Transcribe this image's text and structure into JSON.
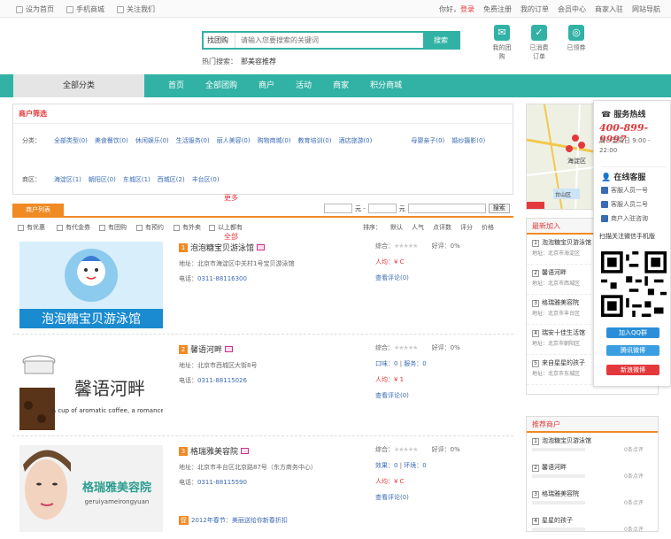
{
  "topbar": {
    "left": [
      "设为首页",
      "手机商城",
      "关注我们"
    ],
    "right": [
      "你好，",
      "登录",
      "免费注册",
      "我的订单",
      "会员中心",
      "商家入驻",
      "网站导航"
    ]
  },
  "search": {
    "category": "找团购",
    "placeholder": "请输入您要搜索的关键词",
    "button": "搜索",
    "hot_label": "热门搜索：",
    "hot_term": "那美容推荐"
  },
  "quick_icons": [
    "我的团购",
    "已消费订单",
    "已领券"
  ],
  "nav": {
    "all": "全部分类",
    "items": [
      "首页",
      "全部团购",
      "商户",
      "活动",
      "商家",
      "积分商城"
    ]
  },
  "filter": {
    "title": "商户筛选",
    "cat_label": "分类：",
    "categories": [
      "全部类型(0)",
      "美食餐饮(0)",
      "休闲娱乐(0)",
      "生活服务(0)",
      "丽人美容(0)",
      "购物商城(0)",
      "教育培训(0)",
      "酒店旅游(0)",
      "母婴亲子(0)",
      "婚纱摄影(0)",
      "更多"
    ],
    "area_label": "商区：",
    "areas": [
      "海淀区(1)",
      "朝阳区(0)",
      "东城区(1)",
      "西城区(2)",
      "丰台区(0)",
      "全部"
    ]
  },
  "list_tab": "商户列表",
  "price": {
    "sep1": "元 -",
    "sep2": "元",
    "go": "搜索"
  },
  "checks": [
    "有优惠",
    "有代金券",
    "有团购",
    "有预约",
    "有外卖",
    "以上都有"
  ],
  "sorts": [
    "排序：",
    "默认",
    "人气",
    "点评数",
    "评分",
    "价格"
  ],
  "shops": [
    {
      "num": "1",
      "name": "泡泡糖宝贝游泳馆",
      "addr": "地址：北京市海淀区中关村1号宝贝游泳馆",
      "tel_label": "电话：",
      "tel": "0311-88116300",
      "score": "综合：",
      "praise": "好评：0%",
      "avg": "人均：¥ C",
      "review": "查看评论(0)",
      "logo": "泡泡糖宝贝游泳馆"
    },
    {
      "num": "2",
      "name": "馨语河畔",
      "addr": "地址：北京市西城区大街8号",
      "tel_label": "电话：",
      "tel": "0311-88115026",
      "score": "综合：",
      "praise": "好评：0%",
      "taste": "口味：0",
      "env": "服务：0",
      "avg": "人均：¥ 1",
      "review": "查看评论(0)",
      "logo_cn": "馨语河畔",
      "logo_en": "A cup of aromatic coffee, a romance"
    },
    {
      "num": "3",
      "name": "格瑞雅美容院",
      "addr": "地址：北京市丰台区北京路87号（东方商务中心）",
      "tel_label": "电话：",
      "tel": "0311-88115590",
      "score": "综合：",
      "praise": "好评：0%",
      "taste": "效果：0",
      "env": "环境：0",
      "avg": "人均：¥ C",
      "review": "查看评论(0)",
      "promo_tag": "促",
      "promo": "2012年春节：美丽送给你新春折扣",
      "logo_cn": "格瑞雅美容院",
      "logo_en": "geruiyameirongyuan"
    }
  ],
  "map": {
    "label": "海淀区",
    "label2": "台山区"
  },
  "new_shops": {
    "title": "最新加入",
    "items": [
      {
        "n": "1",
        "name": "泡泡糖宝贝游泳馆",
        "sub": "地址：北京市海淀区"
      },
      {
        "n": "2",
        "name": "馨语河畔",
        "sub": "地址：北京市西城区"
      },
      {
        "n": "3",
        "name": "格瑞雅美容院",
        "sub": "地址：北京市丰台区"
      },
      {
        "n": "4",
        "name": "瑞安十佳生活馆",
        "sub": "地址：北京市朝阳区"
      },
      {
        "n": "5",
        "name": "来自星星的孩子",
        "sub": "地址：北京市东城区"
      }
    ]
  },
  "rec_shops": {
    "title": "推荐商户",
    "items": [
      {
        "n": "1",
        "name": "泡泡糖宝贝游泳馆",
        "score": "0条点评"
      },
      {
        "n": "2",
        "name": "馨语河畔",
        "score": "0条点评"
      },
      {
        "n": "3",
        "name": "格瑞雅美容院",
        "score": "0条点评"
      },
      {
        "n": "4",
        "name": "星星的孩子",
        "score": "0条点评"
      }
    ]
  },
  "service": {
    "title": "服务热线",
    "tel": "400-899-9997",
    "time": "周一至周日 9:00 - 22:00",
    "online": "在线客服",
    "agents": [
      "客服人员一号",
      "客服人员二号",
      "商户入驻咨询"
    ],
    "wx": "扫描关注微信手机版",
    "btn1": "加入QQ群",
    "btn2": "腾讯微博",
    "btn3": "新浪微博"
  }
}
